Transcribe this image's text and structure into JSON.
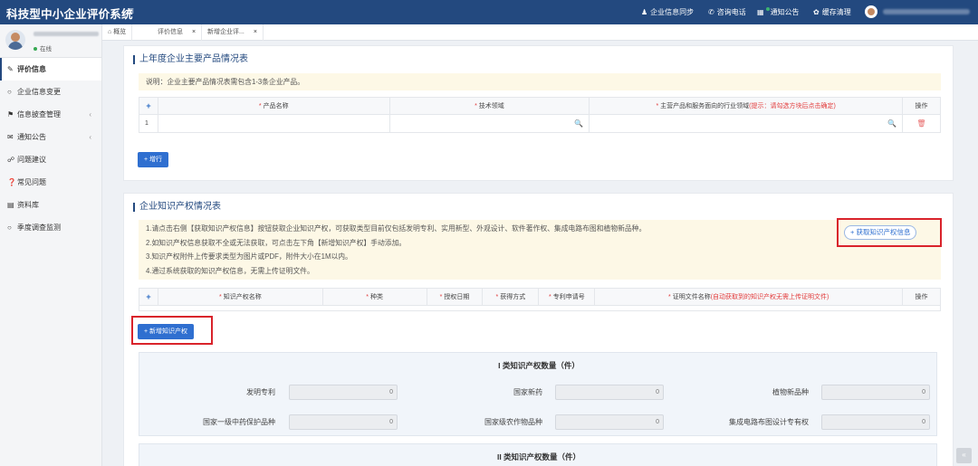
{
  "header": {
    "title": "科技型中小企业评价系统",
    "menu_icon": "≡",
    "links": [
      {
        "icon": "user-icon",
        "label": "企业信息同步"
      },
      {
        "icon": "phone-icon",
        "label": "咨询电话"
      },
      {
        "icon": "notice-icon",
        "label": "通知公告"
      },
      {
        "icon": "clear-cache-icon",
        "label": "缓存清理"
      }
    ]
  },
  "sidebar": {
    "status": "在线",
    "items": [
      {
        "label": "评价信息",
        "icon": "edit-icon",
        "active": true
      },
      {
        "label": "企业信息变更",
        "icon": "circle-icon"
      },
      {
        "label": "信息披查管理",
        "icon": "tags-icon",
        "arrow": "‹"
      },
      {
        "label": "通知公告",
        "icon": "mail-icon",
        "arrow": "‹"
      },
      {
        "label": "问题建议",
        "icon": "comment-icon"
      },
      {
        "label": "常见问题",
        "icon": "question-icon"
      },
      {
        "label": "资料库",
        "icon": "folder-icon"
      },
      {
        "label": "季度调查监测",
        "icon": "circle-icon"
      }
    ]
  },
  "tabs": [
    {
      "label": "概览",
      "icon": "home-icon"
    },
    {
      "label": "评价信息",
      "close": "×"
    },
    {
      "label": "新增企业评...",
      "close": "×"
    }
  ],
  "products": {
    "title": "上年度企业主要产品情况表",
    "note": "说明：企业主要产品情况表需包含1-3条企业产品。",
    "columns": [
      "产品名称",
      "技术领域",
      "主营产品和服务面向的行业领域"
    ],
    "col3_hint": "(提示：请勾选方块后点击确定)",
    "op_label": "操作",
    "plus": "+",
    "row_index": "1",
    "add_row_button": "+ 增行"
  },
  "ip": {
    "title": "企业知识产权情况表",
    "notes": [
      "1.请点击右侧【获取知识产权信息】按钮获取企业知识产权，可获取类型目前仅包括发明专利、实用新型、外观设计、软件著作权、集成电路布图和植物新品种。",
      "2.如知识产权信息获取不全或无法获取，可点击左下角【新增知识产权】手动添加。",
      "3.知识产权附件上传要求类型为图片或PDF，附件大小在1M以内。",
      "4.通过系统获取的知识产权信息，无需上传证明文件。"
    ],
    "fetch_button": "+ 获取知识产权信息",
    "columns": [
      "知识产权名称",
      "种类",
      "授权日期",
      "获得方式",
      "专利申请号",
      "证明文件名称"
    ],
    "col6_hint": "(自动获取到的知识产权无需上传证明文件)",
    "op_label": "操作",
    "add_button": "+ 新增知识产权"
  },
  "class1": {
    "title": "I 类知识产权数量（件）",
    "fields": [
      {
        "label": "发明专利",
        "value": "0"
      },
      {
        "label": "国家新药",
        "value": "0"
      },
      {
        "label": "植物新品种",
        "value": "0"
      },
      {
        "label": "国家一级中药保护品种",
        "value": "0"
      },
      {
        "label": "国家级农作物品种",
        "value": "0"
      },
      {
        "label": "集成电路布图设计专有权",
        "value": "0"
      }
    ]
  },
  "class2": {
    "title": "II 类知识产权数量（件）"
  },
  "scroll_top": "«"
}
